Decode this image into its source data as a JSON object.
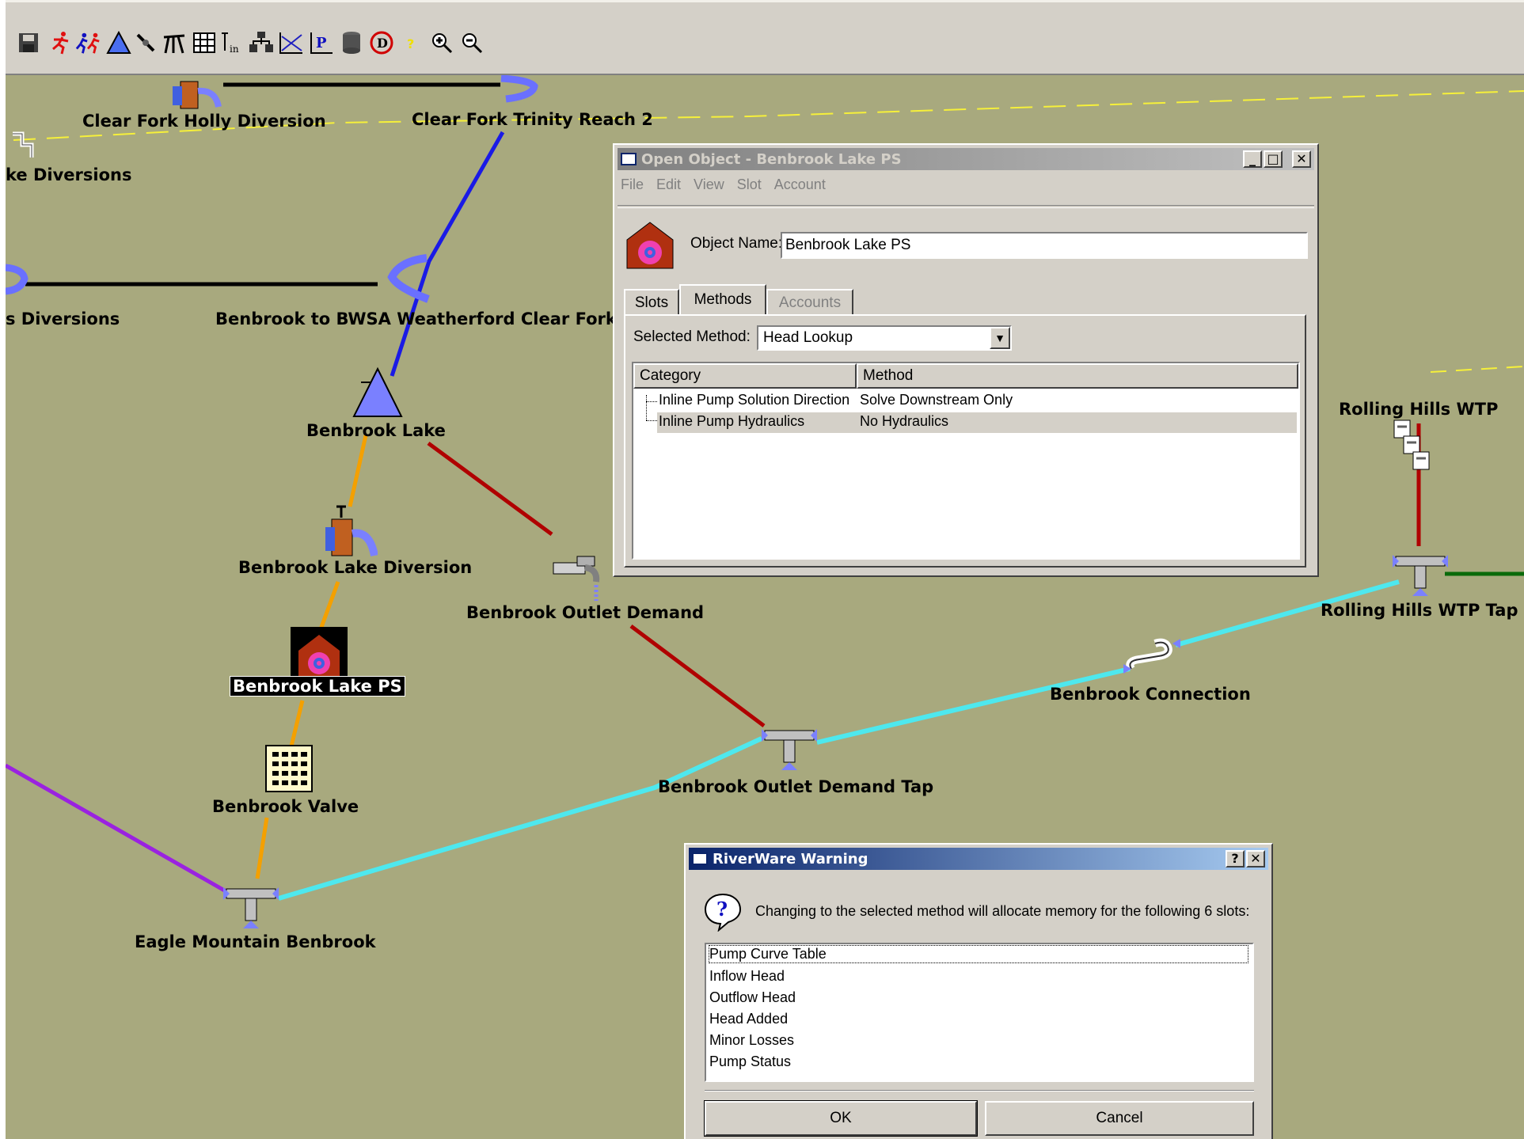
{
  "toolbar": {
    "icons": [
      "save-icon",
      "run-icon",
      "run-multiple-icon",
      "reservoir-icon",
      "link-icon",
      "survey-icon",
      "table-icon",
      "inflow-icon",
      "network-icon",
      "plot-icon",
      "policy-icon",
      "database-icon",
      "diagnostics-icon",
      "help-icon",
      "zoom-in-icon",
      "zoom-out-icon"
    ]
  },
  "workspace": {
    "nodes": [
      {
        "id": "clear-fork-holly-diversion",
        "label": "Clear Fork Holly Diversion"
      },
      {
        "id": "clear-fork-trinity-reach-2",
        "label": "Clear Fork Trinity Reach 2"
      },
      {
        "id": "lake-diversions",
        "label": "ke Diversions"
      },
      {
        "id": "diversions",
        "label": "s Diversions"
      },
      {
        "id": "benbrook-to-bwsa",
        "label": "Benbrook to BWSA Weatherford Clear Fork"
      },
      {
        "id": "benbrook-lake",
        "label": "Benbrook Lake"
      },
      {
        "id": "benbrook-lake-diversion",
        "label": "Benbrook Lake Diversion"
      },
      {
        "id": "benbrook-outlet-demand",
        "label": "Benbrook Outlet Demand"
      },
      {
        "id": "benbrook-lake-ps",
        "label": "Benbrook Lake PS"
      },
      {
        "id": "benbrook-valve",
        "label": "Benbrook Valve"
      },
      {
        "id": "eagle-mountain-benbrook",
        "label": "Eagle Mountain Benbrook"
      },
      {
        "id": "benbrook-outlet-demand-tap",
        "label": "Benbrook Outlet Demand Tap"
      },
      {
        "id": "benbrook-connection",
        "label": "Benbrook Connection"
      },
      {
        "id": "rolling-hills-wtp",
        "label": "Rolling Hills WTP"
      },
      {
        "id": "rolling-hills-wtp-tap",
        "label": "Rolling Hills WTP Tap"
      }
    ]
  },
  "open_object": {
    "title": "Open Object - Benbrook Lake PS",
    "menu": [
      "File",
      "Edit",
      "View",
      "Slot",
      "Account"
    ],
    "object_name_label": "Object Name:",
    "object_name_value": "Benbrook Lake PS",
    "tabs": [
      "Slots",
      "Methods",
      "Accounts"
    ],
    "active_tab": "Methods",
    "selected_method_label": "Selected Method:",
    "selected_method_value": "Head Lookup",
    "table_headers": [
      "Category",
      "Method"
    ],
    "rows": [
      {
        "category": "Inline Pump Solution Direction",
        "method": "Solve Downstream Only"
      },
      {
        "category": "Inline Pump Hydraulics",
        "method": "No Hydraulics"
      }
    ]
  },
  "warning": {
    "title": "RiverWare Warning",
    "message": "Changing to the selected method will allocate memory for the following 6 slots:",
    "slots": [
      "Pump Curve Table",
      "Inflow Head",
      "Outflow Head",
      "Head Added",
      "Minor Losses",
      "Pump Status"
    ],
    "ok_label": "OK",
    "cancel_label": "Cancel"
  },
  "colors": {
    "canvas": "#a8a97e",
    "cyan_pipe": "#4ee8ee",
    "orange_link": "#f4a000",
    "red_link": "#b00000",
    "blue_reach": "#1a1ae6",
    "purple_link": "#9a22e0",
    "green_link": "#0a6a0a",
    "yellow_dash": "#f6f03a"
  }
}
